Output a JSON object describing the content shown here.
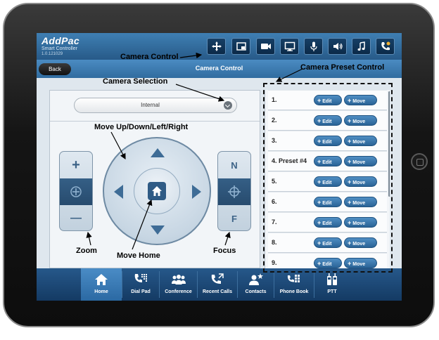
{
  "app": {
    "brand": "AddPac",
    "subtitle": "Smart Controller",
    "version": "1.0.121029"
  },
  "top_toolbar": {
    "buttons": [
      {
        "id": "camera-control",
        "icon": "move-arrows-icon"
      },
      {
        "id": "video-window",
        "icon": "window-icon"
      },
      {
        "id": "video-camera",
        "icon": "video-camera-icon"
      },
      {
        "id": "display",
        "icon": "monitor-icon"
      },
      {
        "id": "microphone",
        "icon": "microphone-icon"
      },
      {
        "id": "volume",
        "icon": "speaker-icon"
      },
      {
        "id": "music",
        "icon": "music-note-icon"
      },
      {
        "id": "call-settings",
        "icon": "phone-gear-icon"
      }
    ]
  },
  "title_bar": {
    "back_label": "Back",
    "title": "Camera Control"
  },
  "camera": {
    "selection": "Internal",
    "zoom": {
      "plus": "+",
      "minus": "—"
    },
    "focus": {
      "near": "N",
      "far": "F"
    }
  },
  "presets": [
    {
      "label": "1.",
      "edit": "Edit",
      "move": "Move"
    },
    {
      "label": "2.",
      "edit": "Edit",
      "move": "Move"
    },
    {
      "label": "3.",
      "edit": "Edit",
      "move": "Move"
    },
    {
      "label": "4. Preset #4",
      "edit": "Edit",
      "move": "Move"
    },
    {
      "label": "5.",
      "edit": "Edit",
      "move": "Move"
    },
    {
      "label": "6.",
      "edit": "Edit",
      "move": "Move"
    },
    {
      "label": "7.",
      "edit": "Edit",
      "move": "Move"
    },
    {
      "label": "8.",
      "edit": "Edit",
      "move": "Move"
    },
    {
      "label": "9.",
      "edit": "Edit",
      "move": "Move"
    }
  ],
  "bottom_nav": [
    {
      "label": "Home",
      "icon": "home-icon",
      "active": true
    },
    {
      "label": "Dial Pad",
      "icon": "dial-pad-icon",
      "active": false
    },
    {
      "label": "Conference",
      "icon": "conference-icon",
      "active": false
    },
    {
      "label": "Recent Calls",
      "icon": "recent-calls-icon",
      "active": false
    },
    {
      "label": "Contacts",
      "icon": "contacts-icon",
      "active": false
    },
    {
      "label": "Phone Book",
      "icon": "phone-book-icon",
      "active": false
    },
    {
      "label": "PTT",
      "icon": "ptt-icon",
      "active": false
    }
  ],
  "annotations": {
    "camera_control": "Camera Control",
    "camera_selection": "Camera  Selection",
    "camera_preset_control": "Camera Preset Control",
    "move_directions": "Move  Up/Down/Left/Right",
    "zoom": "Zoom",
    "move_home": "Move Home",
    "focus": "Focus"
  },
  "colors": {
    "toolbar_blue": "#275a88",
    "button_blue": "#2a6396",
    "nav_active": "#4a8cc6"
  }
}
